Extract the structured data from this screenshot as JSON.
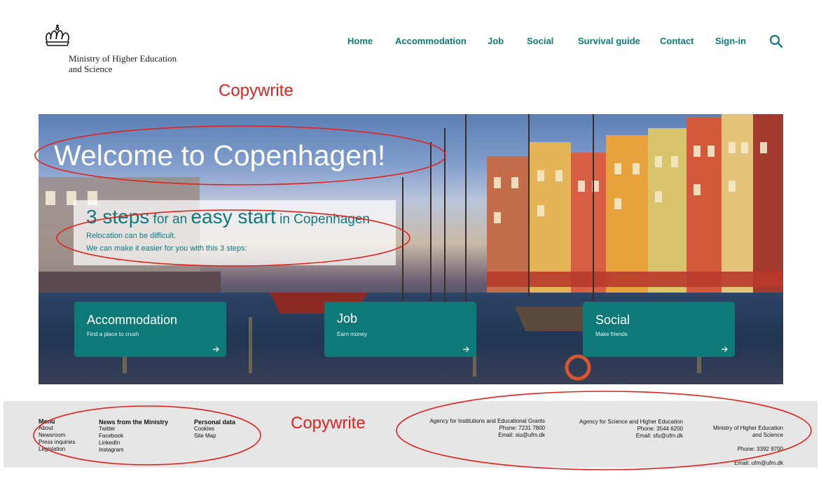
{
  "header": {
    "ministry_name": "Ministry of Higher Education\nand Science",
    "nav": [
      "Home",
      "Accommodation",
      "Job",
      "Social",
      "Survival guide",
      "Contact",
      "Sign-in"
    ]
  },
  "annotations": {
    "top": "Copywrite",
    "footer": "Copywrite"
  },
  "hero": {
    "title": "Welcome to Copenhagen!",
    "steps": {
      "part1": "3 steps",
      "part2": " for an ",
      "part3": "easy start",
      "part4": " in Copenhagen",
      "line1": "Relocation can be difficult.",
      "line2": "We can make it easier for you with this 3 steps:"
    },
    "cards": [
      {
        "title": "Accommodation",
        "subtitle": "Find a place to crush"
      },
      {
        "title": "Job",
        "subtitle": "Earn money"
      },
      {
        "title": "Social",
        "subtitle": "Make friends"
      }
    ]
  },
  "footer": {
    "menu": {
      "heading": "Menu",
      "items": [
        "About",
        "Newsroom",
        "Press inquiries",
        "Legislation"
      ]
    },
    "news": {
      "heading": "News from the Ministry",
      "items": [
        "Twitter",
        "Facebook",
        "LinkedIn",
        "Instagram"
      ]
    },
    "personal": {
      "heading": "Personal data",
      "items": [
        "Cookies",
        "Site Map"
      ]
    },
    "agencies": [
      {
        "name": "Agency for Institutions and Educational Grants",
        "phone": "Phone: 7231 7800",
        "email": "Email: siu@ufm.dk"
      },
      {
        "name": "Agency for Science and Higher Education",
        "phone": "Phone: 3544 6200",
        "email": "Email: sfu@ufm.dk"
      },
      {
        "name": "Ministry of Higher Education\nand Science",
        "phone": "Phone: 3392 9700",
        "email": "Email: ufm@ufm.dk"
      }
    ]
  },
  "colors": {
    "accent": "#0f7a79",
    "annotation": "#e0231f",
    "footer_bg": "#e6e6e6"
  }
}
